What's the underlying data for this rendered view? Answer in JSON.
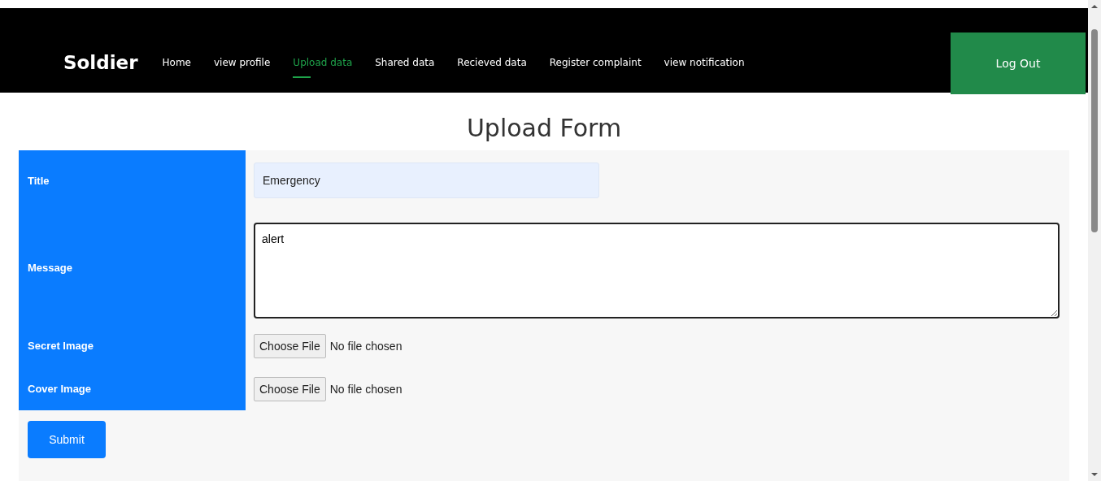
{
  "navbar": {
    "brand": "Soldier",
    "links": [
      {
        "label": "Home",
        "selected": false
      },
      {
        "label": "view profile",
        "selected": false
      },
      {
        "label": "Upload data",
        "selected": true
      },
      {
        "label": "Shared data",
        "selected": false
      },
      {
        "label": "Recieved data",
        "selected": false
      },
      {
        "label": "Register complaint",
        "selected": false
      },
      {
        "label": "view notification",
        "selected": false
      }
    ],
    "logout": "Log Out"
  },
  "form": {
    "heading": "Upload Form",
    "fields": [
      {
        "kind": "text",
        "label": "Title",
        "value": "Emergency"
      },
      {
        "kind": "textarea",
        "label": "Message",
        "value": "alert"
      },
      {
        "kind": "file",
        "label": "Secret Image",
        "button": "Choose File",
        "status": "No file chosen"
      },
      {
        "kind": "file",
        "label": "Cover Image",
        "button": "Choose File",
        "status": "No file chosen"
      }
    ],
    "submit": "Submit"
  }
}
